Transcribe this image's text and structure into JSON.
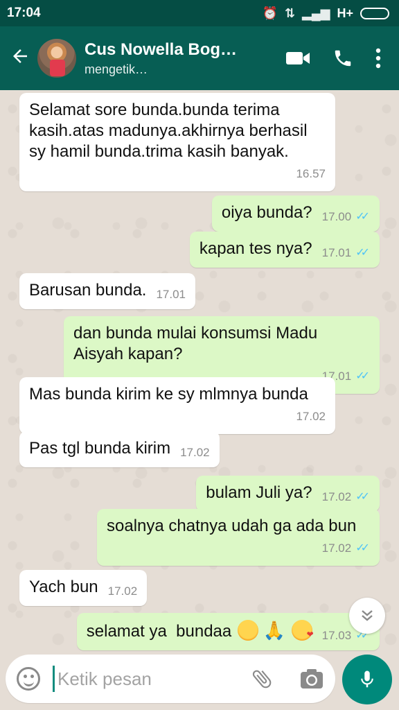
{
  "status_bar": {
    "time": "17:04",
    "network": "H+"
  },
  "header": {
    "contact_name": "Cus Nowella Bog…",
    "contact_status": "mengetik…"
  },
  "messages": [
    {
      "dir": "in",
      "text": "Selamat sore bunda.bunda terima\nkasih.atas madunya.akhirnya berhasil\nsy hamil bunda.trima kasih banyak.",
      "time": "16.57"
    },
    {
      "dir": "out",
      "text": "oiya bunda?",
      "time": "17.00"
    },
    {
      "dir": "out",
      "text": "kapan tes nya?",
      "time": "17.01"
    },
    {
      "dir": "in",
      "text": "Barusan bunda.",
      "time": "17.01"
    },
    {
      "dir": "out",
      "text": "dan bunda mulai konsumsi Madu\nAisyah kapan?",
      "time": "17.01"
    },
    {
      "dir": "in",
      "text": "Mas bunda kirim ke sy mlmnya bunda",
      "time": "17.02"
    },
    {
      "dir": "in",
      "text": "Pas tgl bunda kirim",
      "time": "17.02"
    },
    {
      "dir": "out",
      "text": "bulam Juli ya?",
      "time": "17.02"
    },
    {
      "dir": "out",
      "text": "soalnya chatnya udah ga ada bun",
      "time": "17.02"
    },
    {
      "dir": "in",
      "text": "Yach bun",
      "time": "17.02"
    },
    {
      "dir": "out",
      "text": "selamat ya  bundaa",
      "time": "17.03",
      "emojis": [
        "smiling-face-emoji",
        "folded-hands-emoji",
        "kissing-face-emoji"
      ]
    }
  ],
  "input": {
    "placeholder": "Ketik pesan",
    "value": ""
  },
  "colors": {
    "header": "#075e54",
    "status_bar": "#054d44",
    "outgoing_bubble": "#dcf8c6",
    "incoming_bubble": "#ffffff",
    "read_ticks": "#4fc3f7",
    "mic_button": "#00897b"
  },
  "icons": {
    "back": "arrow-left-icon",
    "video": "video-call-icon",
    "call": "phone-icon",
    "menu": "more-vert-icon",
    "emoji": "emoji-icon",
    "attach": "paperclip-icon",
    "camera": "camera-icon",
    "mic": "microphone-icon",
    "scroll": "double-chevron-down-icon"
  }
}
